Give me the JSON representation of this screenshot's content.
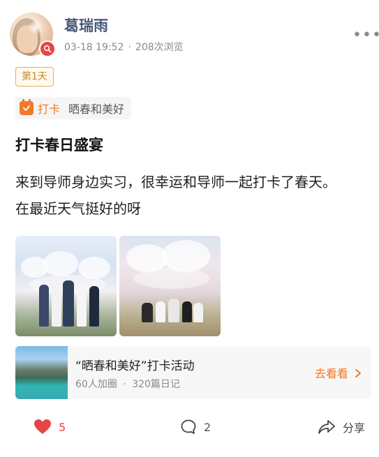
{
  "user": {
    "name": "葛瑞雨",
    "date": "03-18 19:52",
    "separator": "·",
    "views": "208次浏览",
    "more_label": "•••"
  },
  "post": {
    "day_tag": "第1天",
    "chip_label": "打卡",
    "topic": "晒春和美好",
    "title": "打卡春日盛宴",
    "body": "来到导师身边实习，很幸运和导师一起打卡了春天。在最近天气挺好的呀"
  },
  "activity": {
    "title": "“晒春和美好”打卡活动",
    "members": "60人加圈",
    "separator": "·",
    "diaries": "320篇日记",
    "link_label": "去看看"
  },
  "footer": {
    "likes": "5",
    "comments": "2",
    "share_label": "分享"
  },
  "colors": {
    "accent_orange": "#f07a2a",
    "like_red": "#e64545",
    "name_blue": "#4a5a7a",
    "day_tag_gold": "#c98a16"
  },
  "icons": {
    "like": "heart-icon",
    "comment": "comment-bubble-icon",
    "share": "share-arrow-icon",
    "chip": "calendar-check-icon",
    "more": "more-dots-icon",
    "avatar_badge": "search-icon",
    "link": "chevron-right-icon"
  }
}
